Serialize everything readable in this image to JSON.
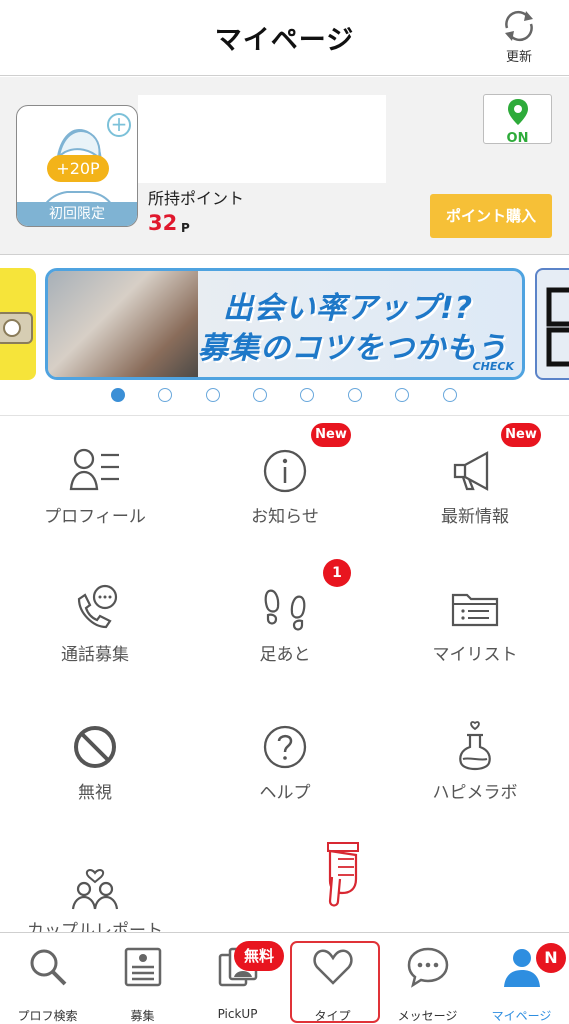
{
  "header": {
    "title": "マイページ",
    "refresh_label": "更新"
  },
  "profile": {
    "bonus_pill": "+20P",
    "limited_label": "初回限定",
    "points_label": "所持ポイント",
    "points_value": "32",
    "points_unit": "P",
    "location_toggle": "ON",
    "buy_points_label": "ポイント購入"
  },
  "banner": {
    "line1": "出会い率アップ!?",
    "line2": "募集のコツをつかもう",
    "tag": "CHECK",
    "slide_count": 8,
    "active_slide": 1
  },
  "menu": {
    "items": [
      {
        "label": "プロフィール",
        "icon": "profile-list-icon"
      },
      {
        "label": "お知らせ",
        "icon": "info-icon",
        "badge": "New"
      },
      {
        "label": "最新情報",
        "icon": "megaphone-icon",
        "badge": "New"
      },
      {
        "label": "通話募集",
        "icon": "phone-chat-icon"
      },
      {
        "label": "足あと",
        "icon": "footprints-icon",
        "badge": "1"
      },
      {
        "label": "マイリスト",
        "icon": "folder-list-icon"
      },
      {
        "label": "無視",
        "icon": "block-icon"
      },
      {
        "label": "ヘルプ",
        "icon": "help-icon"
      },
      {
        "label": "ハピメラボ",
        "icon": "flask-icon"
      },
      {
        "label": "カップルレポート",
        "icon": "couple-icon"
      }
    ]
  },
  "tabbar": {
    "items": [
      {
        "label": "プロフ検索",
        "icon": "search-icon"
      },
      {
        "label": "募集",
        "icon": "board-icon"
      },
      {
        "label": "PickUP",
        "icon": "photos-icon",
        "badge": "無料"
      },
      {
        "label": "タイプ",
        "icon": "heart-icon"
      },
      {
        "label": "メッセージ",
        "icon": "chat-bubble-icon"
      },
      {
        "label": "マイページ",
        "icon": "person-icon",
        "badge": "N"
      }
    ],
    "active": "マイページ"
  },
  "colors": {
    "accent_blue": "#2e8ee0",
    "badge_red": "#e8151f",
    "points_red": "#e0182d",
    "buy_button": "#f6c037",
    "on_green": "#2eab3a"
  }
}
